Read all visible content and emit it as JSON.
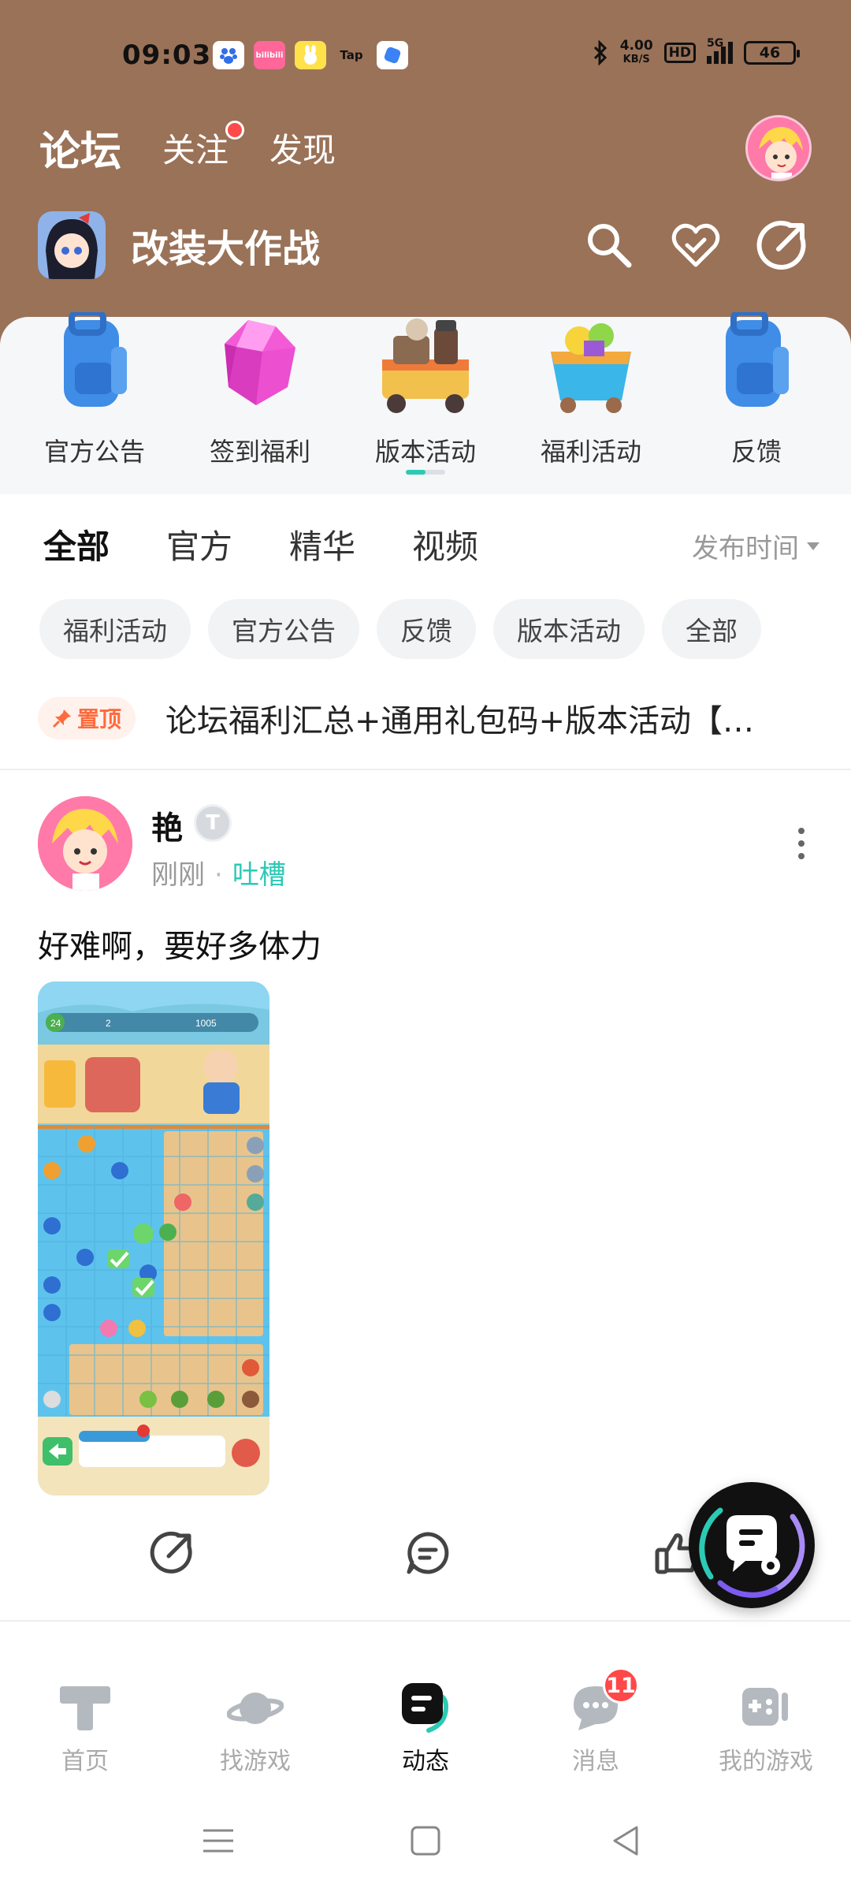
{
  "status_bar": {
    "time": "09:03",
    "speed_value": "4.00",
    "speed_unit": "KB/S",
    "hd": "HD",
    "network": "5G",
    "battery": "46",
    "app_tap": "Tap",
    "app_bilibili": "bilibili"
  },
  "top_tabs": [
    {
      "label": "论坛",
      "active": true
    },
    {
      "label": "关注",
      "has_dot": true
    },
    {
      "label": "发现"
    }
  ],
  "game": {
    "title": "改装大作战"
  },
  "boards": [
    {
      "label": "官方公告",
      "icon": "backpack-icon"
    },
    {
      "label": "签到福利",
      "icon": "gem-icon"
    },
    {
      "label": "版本活动",
      "icon": "food-cart-icon"
    },
    {
      "label": "福利活动",
      "icon": "basket-icon"
    },
    {
      "label": "反馈",
      "icon": "backpack-icon"
    }
  ],
  "filter_tabs": [
    {
      "label": "全部",
      "active": true
    },
    {
      "label": "官方"
    },
    {
      "label": "精华"
    },
    {
      "label": "视频"
    }
  ],
  "sort_label": "发布时间",
  "chips": [
    "福利活动",
    "官方公告",
    "反馈",
    "版本活动",
    "全部"
  ],
  "pinned": {
    "badge": "置顶",
    "title": "论坛福利汇总+通用礼包码+版本活动【实..."
  },
  "post": {
    "username": "艳",
    "level_badge": "T",
    "time": "刚刚",
    "category": "吐槽",
    "text": "好难啊，要好多体力",
    "image_texts": {
      "coins": "1005",
      "energy": "2",
      "level": "24"
    }
  },
  "bottom_nav": [
    {
      "label": "首页",
      "icon": "home-icon"
    },
    {
      "label": "找游戏",
      "icon": "planet-icon"
    },
    {
      "label": "动态",
      "icon": "moments-icon",
      "active": true
    },
    {
      "label": "消息",
      "icon": "message-icon",
      "badge": "11"
    },
    {
      "label": "我的游戏",
      "icon": "gamepad-icon"
    }
  ],
  "colors": {
    "header_bg": "#9a7258",
    "accent": "#2cc9b4",
    "badge_red": "#ff4848",
    "pin_orange": "#ff6b3d"
  }
}
